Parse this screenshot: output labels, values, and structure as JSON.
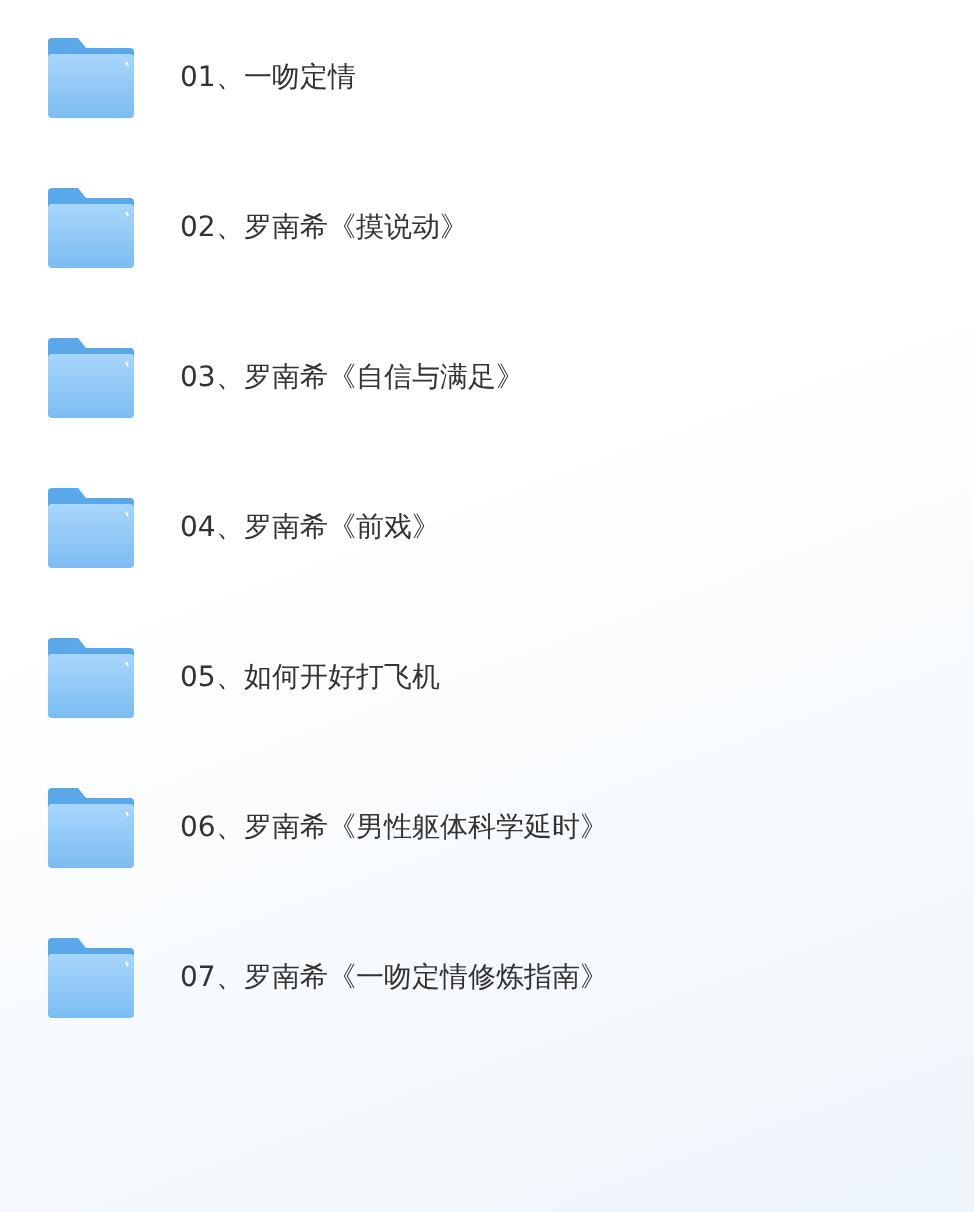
{
  "folders": [
    {
      "name": "01、一吻定情"
    },
    {
      "name": "02、罗南希《摸说动》"
    },
    {
      "name": "03、罗南希《自信与满足》"
    },
    {
      "name": "04、罗南希《前戏》"
    },
    {
      "name": "05、如何开好打飞机"
    },
    {
      "name": "06、罗南希《男性躯体科学延时》"
    },
    {
      "name": "07、罗南希《一吻定情修炼指南》"
    }
  ]
}
